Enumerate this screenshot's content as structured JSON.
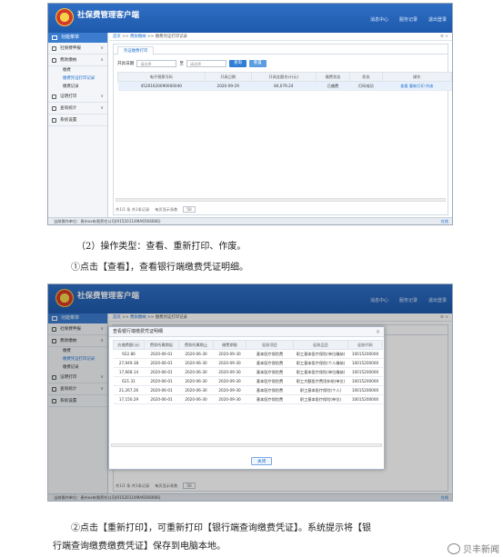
{
  "app": {
    "title": "社保费管理客户端",
    "top_links": [
      "消息中心",
      "服务记录",
      "退出登录"
    ]
  },
  "sidebar": {
    "header": "功能菜单",
    "groups": [
      {
        "label": "社保费申报",
        "arrow": "∨"
      },
      {
        "label": "费款缴纳",
        "arrow": "∧",
        "subs": [
          "缴费",
          "缴费凭证打印记录",
          "缴费记录"
        ]
      },
      {
        "label": "证明打印",
        "arrow": "∨"
      },
      {
        "label": "查询统计",
        "arrow": "∨"
      },
      {
        "label": "系统设置",
        "arrow": ""
      }
    ]
  },
  "screen1": {
    "breadcrumb": {
      "home": "首页",
      "sep1": ">>",
      "mid": "费款缴纳",
      "sep2": ">>",
      "current": "缴费凭证打印记录",
      "right": "⚙ ×"
    },
    "tab": "凭证缴费打印",
    "filters": {
      "label": "开具日期",
      "from_placeholder": "请选择",
      "to": "至",
      "to_placeholder": "请选择",
      "query": "查询",
      "reset": "重置"
    },
    "table": {
      "headers": [
        "电子税票号码",
        "开具日期",
        "开具金额合计(元)",
        "缴费状态",
        "状态",
        "操作"
      ],
      "rows": [
        {
          "no": "45201620090000040",
          "date": "2020-09-29",
          "amount": "84,079.24",
          "pay": "已缴费",
          "status": "打印成功",
          "ops": [
            "查看",
            "重新打印",
            "作废"
          ]
        }
      ]
    },
    "pager": {
      "info": "共1/1 条 共1条记录",
      "mid": "每页显示条数",
      "size": "50"
    }
  },
  "screen2": {
    "breadcrumb": {
      "home": "首页",
      "sep1": ">>",
      "mid": "费款缴纳",
      "sep2": ">>",
      "current": "缴费凭证打印记录",
      "right": "⚙ ×"
    },
    "tab": "凭证缴费打印",
    "modal": {
      "title": "查看银行端缴费凭证明细",
      "close": "×",
      "headers": [
        "应缴费额(元)",
        "费款所属期起",
        "费款所属期止",
        "缴费期限",
        "征收项目",
        "征收品目",
        "征收代码"
      ],
      "rows": [
        [
          "922.86",
          "2020-06-01",
          "2020-06-30",
          "2020-09-30",
          "基本医疗保险费",
          "职工基本医疗保险(单位缴纳)",
          "10015200000"
        ],
        [
          "27,949.38",
          "2020-06-01",
          "2020-06-30",
          "2020-09-30",
          "基本医疗保险费",
          "职工基本医疗保险(个人缴纳)",
          "10015200000"
        ],
        [
          "17,668.14",
          "2020-06-01",
          "2020-06-30",
          "2020-09-30",
          "基本医疗保险费",
          "职工基本医疗保险(单位缴纳)",
          "10015200000"
        ],
        [
          "621.31",
          "2020-06-01",
          "2020-06-30",
          "2020-09-30",
          "基本医疗保险费",
          "职工大额医疗费用补助(单位)",
          "10015200000"
        ],
        [
          "21,267.26",
          "2020-06-01",
          "2020-06-30",
          "2020-09-30",
          "基本医疗保险费",
          "职工基本医疗保险(个人)",
          "10015200000"
        ],
        [
          "17,150.29",
          "2020-06-01",
          "2020-06-30",
          "2020-09-30",
          "基本医疗保险费",
          "职工基本医疗保险(单位)",
          "10015200000"
        ]
      ],
      "close_button": "关闭"
    },
    "pager": {
      "info": "共1/1 条 共1条记录",
      "mid": "每页显示条数",
      "size": "50"
    }
  },
  "footer": {
    "left": "当前操作单位：贵州xx有限责任公司(91520114MA6566666)",
    "right": "在线"
  },
  "captions": {
    "c1": "（2）操作类型：查看、重新打印、作废。",
    "c2": "①点击【查看】，查看银行端缴费凭证明细。",
    "c3a": "②点击【重新打印】，可重新打印【银行端查询缴费凭证】。系统提示将【银",
    "c3b": "行端查询缴费缴费凭证】保存到电脑本地。"
  },
  "watermark": "贝丰新闻"
}
